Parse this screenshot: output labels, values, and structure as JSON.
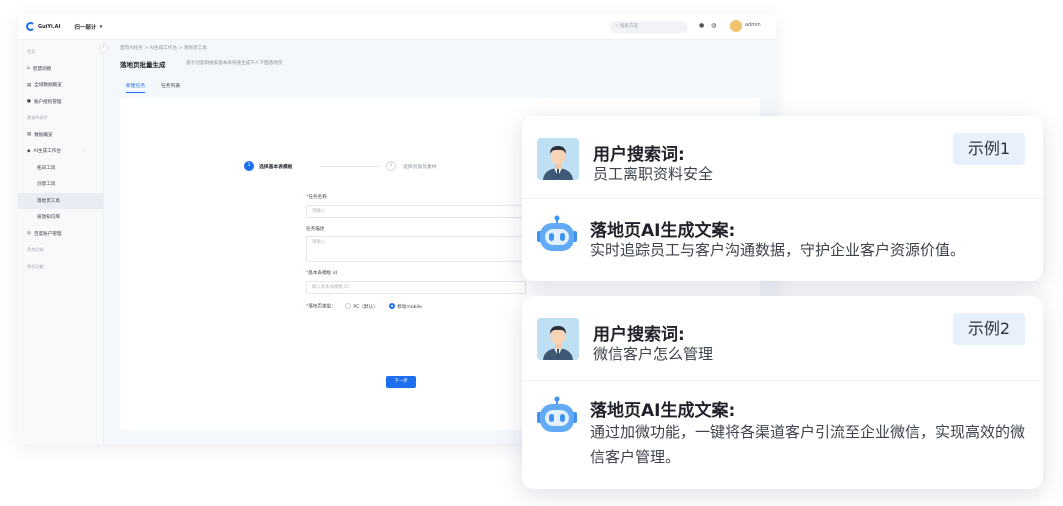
{
  "app": {
    "logo_text": "GuiYi.AI",
    "workspace": "归一部计",
    "search_placeholder": "搜索方案",
    "user": "admin",
    "breadcrumb": "首页AI任务 > AI生成工作台 > 落地页工具",
    "page_title": "落地页批量生成",
    "page_subtitle": "基于创意和搜索基本表快速生成千人千面落地页",
    "tabs": [
      {
        "label": "新建任务",
        "active": true
      },
      {
        "label": "任务列表",
        "active": false
      }
    ],
    "sidebar": {
      "items": [
        {
          "label": "首页",
          "type": "group"
        },
        {
          "label": "智慧洞察",
          "icon": "⌂",
          "type": "item"
        },
        {
          "label": "全域数据概览",
          "icon": "▤",
          "type": "item"
        },
        {
          "label": "账户授权管理",
          "icon": "●",
          "type": "item"
        },
        {
          "label": "营销AI助手",
          "type": "group"
        },
        {
          "label": "数据概览",
          "icon": "▤",
          "type": "item"
        },
        {
          "label": "AI生成工作台",
          "icon": "◆",
          "type": "item",
          "expanded": true
        },
        {
          "label": "拓词工具",
          "type": "sub"
        },
        {
          "label": "创意工具",
          "type": "sub"
        },
        {
          "label": "落地页工具",
          "type": "sub",
          "active": true
        },
        {
          "label": "投放知识库",
          "type": "sub"
        },
        {
          "label": "百度账户管理",
          "icon": "◎",
          "type": "item"
        },
        {
          "label": "系统功能",
          "type": "group"
        },
        {
          "label": "更多功能",
          "type": "group"
        }
      ]
    },
    "steps": [
      {
        "num": "1",
        "label": "选择基本表模板",
        "active": true
      },
      {
        "num": "2",
        "label": "选择创意及素材",
        "active": false
      }
    ],
    "form": {
      "task_name_label": "任务名称",
      "task_name_placeholder": "请输入",
      "task_desc_label": "任务描述",
      "task_desc_placeholder": "请输入",
      "template_label": "基本表模板 id",
      "template_placeholder": "输入基本表模板 ID",
      "type_label": "落地页类型：",
      "type_options": [
        "PC（默认）",
        "移动mobile"
      ],
      "next_button": "下一步"
    }
  },
  "examples": [
    {
      "query_label": "用户搜索词:",
      "query": "员工离职资料安全",
      "badge": "示例1",
      "answer_label": "落地页AI生成文案:",
      "answer": "实时追踪员工与客户沟通数据，守护企业客户资源价值。"
    },
    {
      "query_label": "用户搜索词:",
      "query": "微信客户怎么管理",
      "badge": "示例2",
      "answer_label": "落地页AI生成文案:",
      "answer": "通过加微功能，一键将各渠道客户引流至企业微信，实现高效的微信客户管理。"
    }
  ]
}
